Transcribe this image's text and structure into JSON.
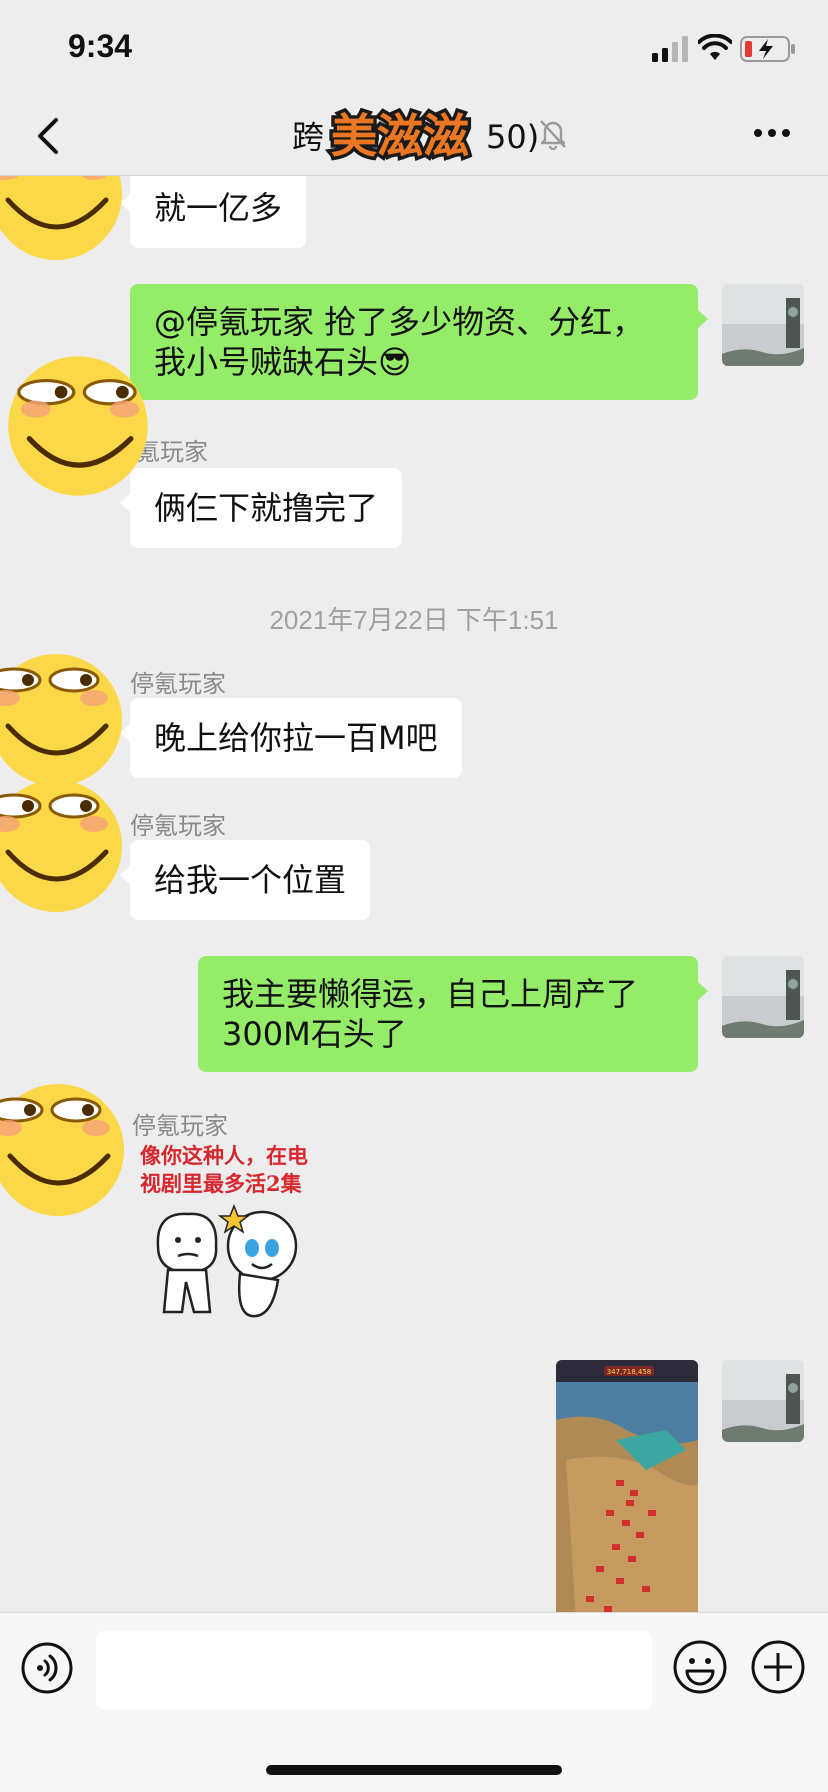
{
  "status_bar": {
    "time": "9:34"
  },
  "header": {
    "title_prefix": "跨",
    "title_suffix": "50)",
    "title_sticker_text": "美滋滋",
    "icons": [
      "back-icon",
      "mute-bell-icon",
      "more-icon"
    ]
  },
  "messages": [
    {
      "direction": "in",
      "sender": "",
      "text": "就一亿多"
    },
    {
      "direction": "out",
      "text": "@停氪玩家 抢了多少物资、分红，\n我小号贼缺石头😎"
    },
    {
      "direction": "in",
      "sender": "氪玩家",
      "text": "俩仨下就撸完了"
    },
    {
      "direction": "in",
      "sender": "停氪玩家",
      "text": "晚上给你拉一百M吧"
    },
    {
      "direction": "in",
      "sender": "停氪玩家",
      "text": "给我一个位置"
    },
    {
      "direction": "out",
      "text": "我主要懒得运，自己上周产了\n300M石头了"
    },
    {
      "direction": "in",
      "sender": "停氪玩家",
      "sticker_text": "像你这种人，在电\n视剧里最多活2集"
    },
    {
      "direction": "out",
      "image": "game-screenshot",
      "image_text": "347,718,458"
    }
  ],
  "timestamp": "2021年7月22日 下午1:51",
  "input_bar": {
    "placeholder": ""
  },
  "colors": {
    "outgoing_bubble": "#95ec69",
    "incoming_bubble": "#ffffff",
    "background": "#ededed"
  }
}
